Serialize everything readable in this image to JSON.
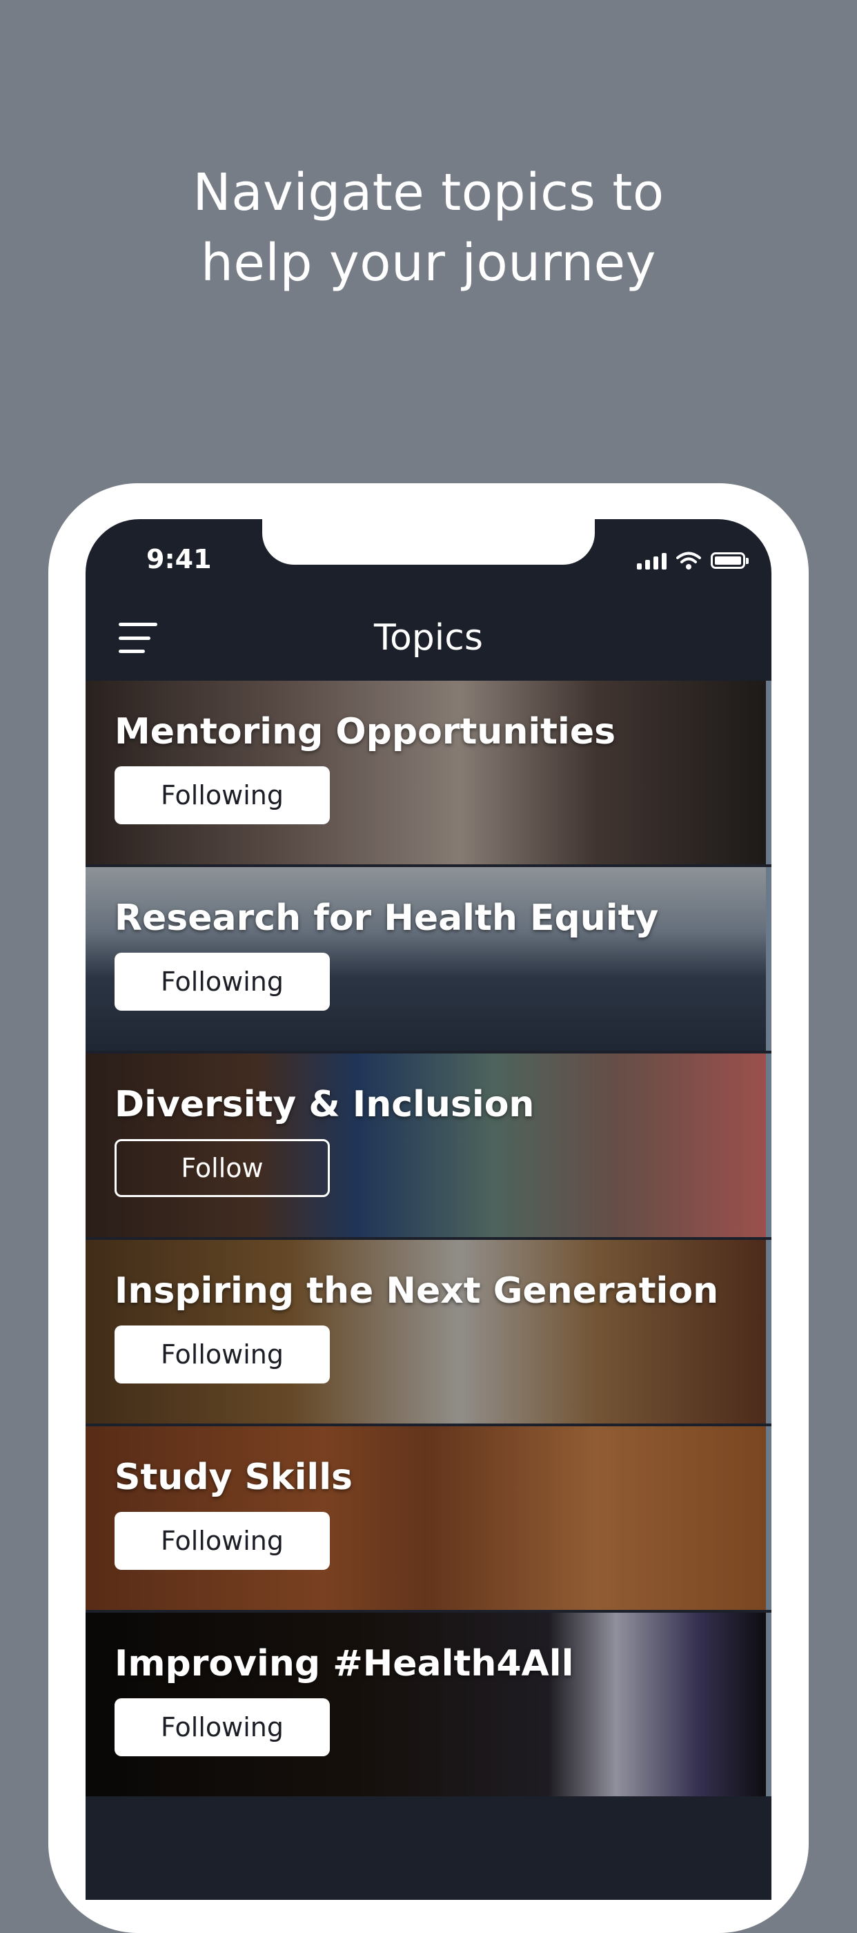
{
  "headline": {
    "line1": "Navigate topics to",
    "line2": "help your journey"
  },
  "status_bar": {
    "time": "9:41",
    "icons": [
      "cellular-signal-icon",
      "wifi-icon",
      "battery-icon"
    ]
  },
  "nav": {
    "title": "Topics",
    "menu_icon": "hamburger-menu-icon"
  },
  "topics": [
    {
      "title": "Mentoring Opportunities",
      "button": "Following",
      "state": "following"
    },
    {
      "title": "Research for Health Equity",
      "button": "Following",
      "state": "following"
    },
    {
      "title": "Diversity & Inclusion",
      "button": "Follow",
      "state": "follow"
    },
    {
      "title": "Inspiring the Next Generation",
      "button": "Following",
      "state": "following"
    },
    {
      "title": "Study Skills",
      "button": "Following",
      "state": "following"
    },
    {
      "title": "Improving #Health4All",
      "button": "Following",
      "state": "following"
    }
  ],
  "colors": {
    "background": "#767d86",
    "phone_frame": "#ffffff",
    "screen": "#1b202b",
    "button_following": "#ffffff",
    "button_follow_border": "#ffffff"
  }
}
